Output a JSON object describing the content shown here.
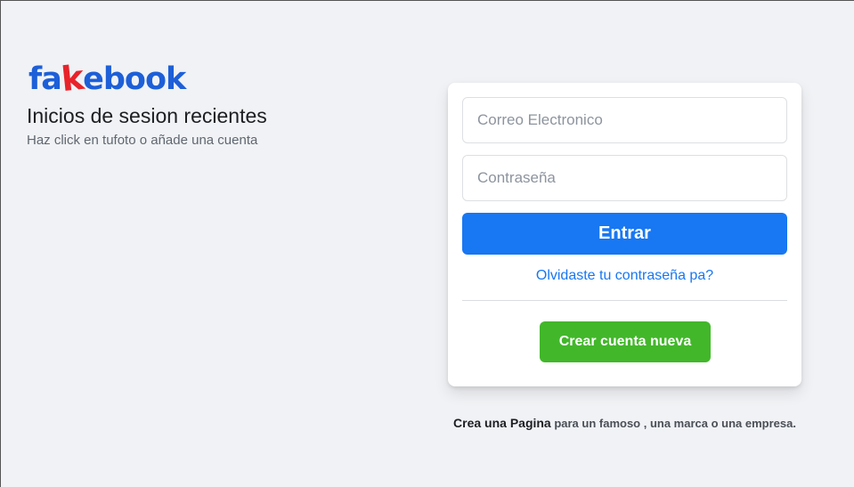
{
  "brand": {
    "logo_prefix": "fa",
    "logo_k": "k",
    "logo_suffix": "ebook",
    "colors": {
      "blue": "#1d5fd8",
      "red": "#e8232a"
    }
  },
  "left": {
    "title": "Inicios de sesion recientes",
    "subtitle": "Haz click en tufoto o añade una cuenta"
  },
  "login": {
    "email_placeholder": "Correo Electronico",
    "email_value": "",
    "password_placeholder": "Contraseña",
    "password_value": "",
    "login_button": "Entrar",
    "forgot_link": "Olvidaste tu contraseña pa?",
    "create_button": "Crear cuenta nueva"
  },
  "footer": {
    "page_link": "Crea una Pagina",
    "page_rest": " para un famoso , una marca o una empresa."
  },
  "colors": {
    "background": "#f0f2f5",
    "primary": "#1877f2",
    "success": "#42b72a"
  }
}
